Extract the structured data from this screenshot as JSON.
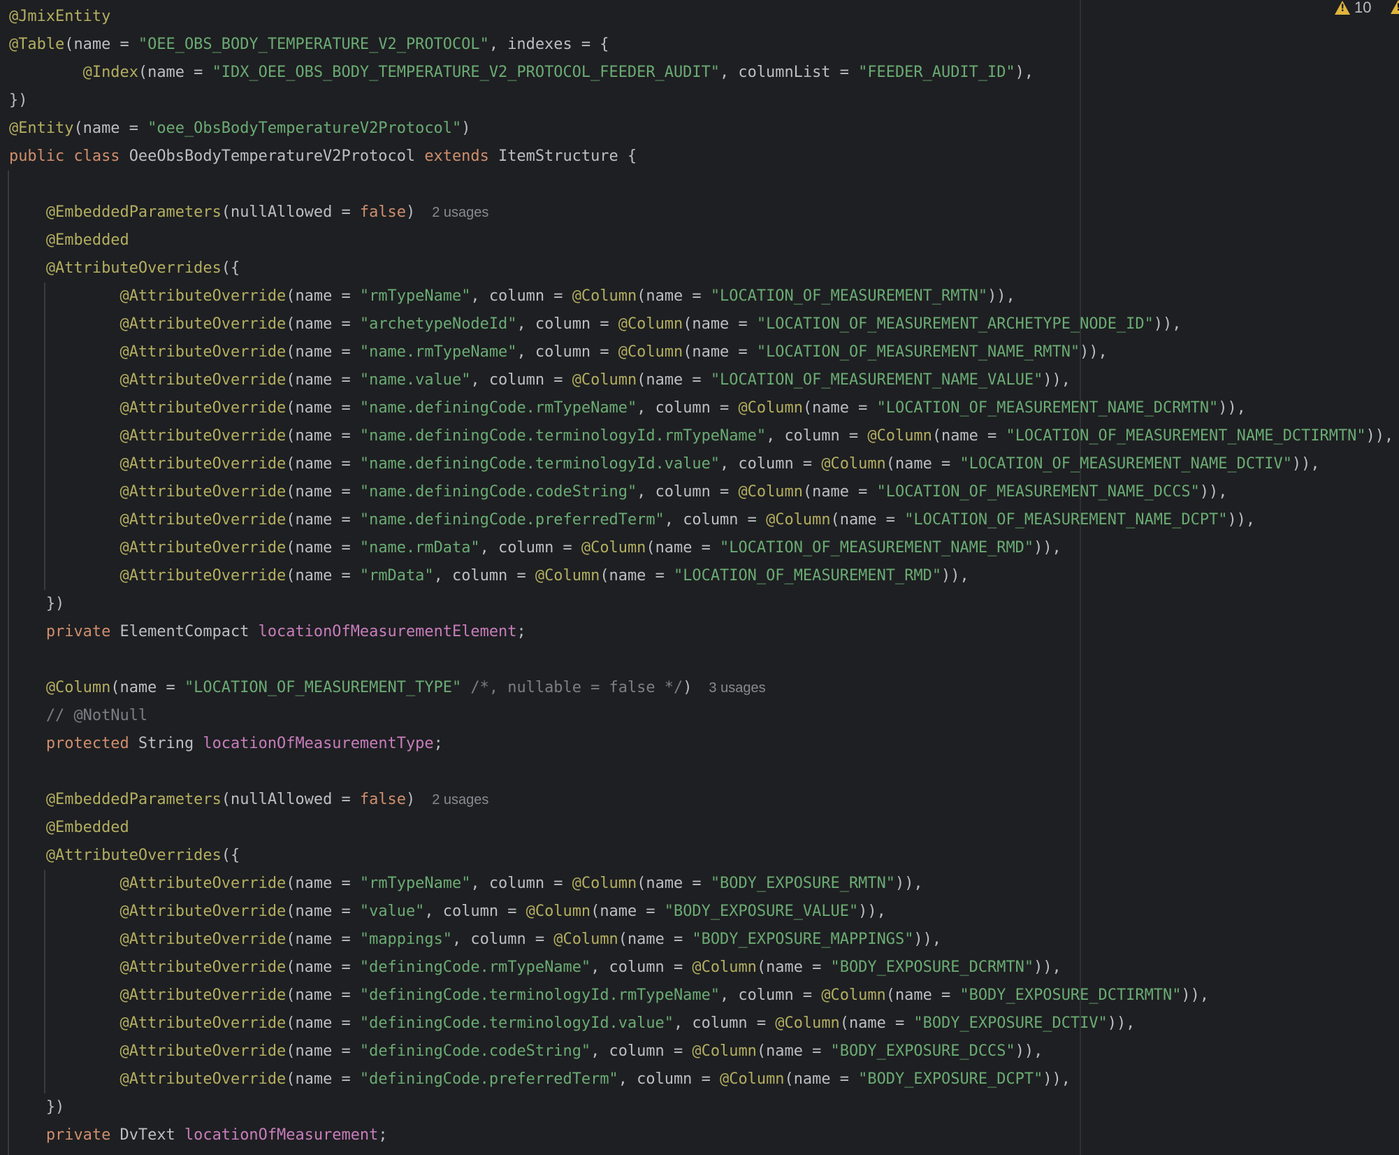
{
  "inspection": {
    "warning_count": "10"
  },
  "colors": {
    "background": "#1e1f22",
    "text": "#bcbec4",
    "annotation": "#b3ae60",
    "keyword": "#cf8e6d",
    "string": "#6aab73",
    "field": "#c77dbb",
    "comment": "#7a7e85",
    "hint": "#868a91",
    "warning": "#e0b53d"
  },
  "code": [
    [
      [
        "ann",
        "@JmixEntity"
      ]
    ],
    [
      [
        "ann",
        "@Table"
      ],
      [
        "txt",
        "(name = "
      ],
      [
        "str",
        "\"OEE_OBS_BODY_TEMPERATURE_V2_PROTOCOL\""
      ],
      [
        "txt",
        ", indexes = {"
      ]
    ],
    [
      [
        "txt",
        "        "
      ],
      [
        "ann",
        "@Index"
      ],
      [
        "txt",
        "(name = "
      ],
      [
        "str",
        "\"IDX_OEE_OBS_BODY_TEMPERATURE_V2_PROTOCOL_FEEDER_AUDIT\""
      ],
      [
        "txt",
        ", columnList = "
      ],
      [
        "str",
        "\"FEEDER_AUDIT_ID\""
      ],
      [
        "txt",
        "),"
      ]
    ],
    [
      [
        "txt",
        "})"
      ]
    ],
    [
      [
        "ann",
        "@Entity"
      ],
      [
        "txt",
        "(name = "
      ],
      [
        "str",
        "\"oee_ObsBodyTemperatureV2Protocol\""
      ],
      [
        "txt",
        ")"
      ]
    ],
    [
      [
        "kw",
        "public class "
      ],
      [
        "txt",
        "OeeObsBodyTemperatureV2Protocol "
      ],
      [
        "kw",
        "extends "
      ],
      [
        "txt",
        "ItemStructure {"
      ]
    ],
    [],
    [
      [
        "txt",
        "    "
      ],
      [
        "ann",
        "@EmbeddedParameters"
      ],
      [
        "txt",
        "(nullAllowed = "
      ],
      [
        "kw",
        "false"
      ],
      [
        "txt",
        ")"
      ],
      [
        "hint",
        "2 usages"
      ]
    ],
    [
      [
        "txt",
        "    "
      ],
      [
        "ann",
        "@Embedded"
      ]
    ],
    [
      [
        "txt",
        "    "
      ],
      [
        "ann",
        "@AttributeOverrides"
      ],
      [
        "txt",
        "({"
      ]
    ],
    [
      [
        "txt",
        "            "
      ],
      [
        "ann",
        "@AttributeOverride"
      ],
      [
        "txt",
        "(name = "
      ],
      [
        "str",
        "\"rmTypeName\""
      ],
      [
        "txt",
        ", column = "
      ],
      [
        "ann",
        "@Column"
      ],
      [
        "txt",
        "(name = "
      ],
      [
        "str",
        "\"LOCATION_OF_MEASUREMENT_RMTN\""
      ],
      [
        "txt",
        ")),"
      ]
    ],
    [
      [
        "txt",
        "            "
      ],
      [
        "ann",
        "@AttributeOverride"
      ],
      [
        "txt",
        "(name = "
      ],
      [
        "str",
        "\"archetypeNodeId\""
      ],
      [
        "txt",
        ", column = "
      ],
      [
        "ann",
        "@Column"
      ],
      [
        "txt",
        "(name = "
      ],
      [
        "str",
        "\"LOCATION_OF_MEASUREMENT_ARCHETYPE_NODE_ID\""
      ],
      [
        "txt",
        ")),"
      ]
    ],
    [
      [
        "txt",
        "            "
      ],
      [
        "ann",
        "@AttributeOverride"
      ],
      [
        "txt",
        "(name = "
      ],
      [
        "str",
        "\"name.rmTypeName\""
      ],
      [
        "txt",
        ", column = "
      ],
      [
        "ann",
        "@Column"
      ],
      [
        "txt",
        "(name = "
      ],
      [
        "str",
        "\"LOCATION_OF_MEASUREMENT_NAME_RMTN\""
      ],
      [
        "txt",
        ")),"
      ]
    ],
    [
      [
        "txt",
        "            "
      ],
      [
        "ann",
        "@AttributeOverride"
      ],
      [
        "txt",
        "(name = "
      ],
      [
        "str",
        "\"name.value\""
      ],
      [
        "txt",
        ", column = "
      ],
      [
        "ann",
        "@Column"
      ],
      [
        "txt",
        "(name = "
      ],
      [
        "str",
        "\"LOCATION_OF_MEASUREMENT_NAME_VALUE\""
      ],
      [
        "txt",
        ")),"
      ]
    ],
    [
      [
        "txt",
        "            "
      ],
      [
        "ann",
        "@AttributeOverride"
      ],
      [
        "txt",
        "(name = "
      ],
      [
        "str",
        "\"name.definingCode.rmTypeName\""
      ],
      [
        "txt",
        ", column = "
      ],
      [
        "ann",
        "@Column"
      ],
      [
        "txt",
        "(name = "
      ],
      [
        "str",
        "\"LOCATION_OF_MEASUREMENT_NAME_DCRMTN\""
      ],
      [
        "txt",
        ")),"
      ]
    ],
    [
      [
        "txt",
        "            "
      ],
      [
        "ann",
        "@AttributeOverride"
      ],
      [
        "txt",
        "(name = "
      ],
      [
        "str",
        "\"name.definingCode.terminologyId.rmTypeName\""
      ],
      [
        "txt",
        ", column = "
      ],
      [
        "ann",
        "@Column"
      ],
      [
        "txt",
        "(name = "
      ],
      [
        "str",
        "\"LOCATION_OF_MEASUREMENT_NAME_DCTIRMTN\""
      ],
      [
        "txt",
        ")),"
      ]
    ],
    [
      [
        "txt",
        "            "
      ],
      [
        "ann",
        "@AttributeOverride"
      ],
      [
        "txt",
        "(name = "
      ],
      [
        "str",
        "\"name.definingCode.terminologyId.value\""
      ],
      [
        "txt",
        ", column = "
      ],
      [
        "ann",
        "@Column"
      ],
      [
        "txt",
        "(name = "
      ],
      [
        "str",
        "\"LOCATION_OF_MEASUREMENT_NAME_DCTIV\""
      ],
      [
        "txt",
        ")),"
      ]
    ],
    [
      [
        "txt",
        "            "
      ],
      [
        "ann",
        "@AttributeOverride"
      ],
      [
        "txt",
        "(name = "
      ],
      [
        "str",
        "\"name.definingCode.codeString\""
      ],
      [
        "txt",
        ", column = "
      ],
      [
        "ann",
        "@Column"
      ],
      [
        "txt",
        "(name = "
      ],
      [
        "str",
        "\"LOCATION_OF_MEASUREMENT_NAME_DCCS\""
      ],
      [
        "txt",
        ")),"
      ]
    ],
    [
      [
        "txt",
        "            "
      ],
      [
        "ann",
        "@AttributeOverride"
      ],
      [
        "txt",
        "(name = "
      ],
      [
        "str",
        "\"name.definingCode.preferredTerm\""
      ],
      [
        "txt",
        ", column = "
      ],
      [
        "ann",
        "@Column"
      ],
      [
        "txt",
        "(name = "
      ],
      [
        "str",
        "\"LOCATION_OF_MEASUREMENT_NAME_DCPT\""
      ],
      [
        "txt",
        ")),"
      ]
    ],
    [
      [
        "txt",
        "            "
      ],
      [
        "ann",
        "@AttributeOverride"
      ],
      [
        "txt",
        "(name = "
      ],
      [
        "str",
        "\"name.rmData\""
      ],
      [
        "txt",
        ", column = "
      ],
      [
        "ann",
        "@Column"
      ],
      [
        "txt",
        "(name = "
      ],
      [
        "str",
        "\"LOCATION_OF_MEASUREMENT_NAME_RMD\""
      ],
      [
        "txt",
        ")),"
      ]
    ],
    [
      [
        "txt",
        "            "
      ],
      [
        "ann",
        "@AttributeOverride"
      ],
      [
        "txt",
        "(name = "
      ],
      [
        "str",
        "\"rmData\""
      ],
      [
        "txt",
        ", column = "
      ],
      [
        "ann",
        "@Column"
      ],
      [
        "txt",
        "(name = "
      ],
      [
        "str",
        "\"LOCATION_OF_MEASUREMENT_RMD\""
      ],
      [
        "txt",
        ")),"
      ]
    ],
    [
      [
        "txt",
        "    })"
      ]
    ],
    [
      [
        "txt",
        "    "
      ],
      [
        "kw",
        "private "
      ],
      [
        "txt",
        "ElementCompact "
      ],
      [
        "field",
        "locationOfMeasurementElement"
      ],
      [
        "txt",
        ";"
      ]
    ],
    [],
    [
      [
        "txt",
        "    "
      ],
      [
        "ann",
        "@Column"
      ],
      [
        "txt",
        "(name = "
      ],
      [
        "str",
        "\"LOCATION_OF_MEASUREMENT_TYPE\""
      ],
      [
        "txt",
        " "
      ],
      [
        "cmt",
        "/*, nullable = false */"
      ],
      [
        "txt",
        ")"
      ],
      [
        "hint",
        "3 usages"
      ]
    ],
    [
      [
        "txt",
        "    "
      ],
      [
        "cmt",
        "// @NotNull"
      ]
    ],
    [
      [
        "txt",
        "    "
      ],
      [
        "kw",
        "protected "
      ],
      [
        "txt",
        "String "
      ],
      [
        "field",
        "locationOfMeasurementType"
      ],
      [
        "txt",
        ";"
      ]
    ],
    [],
    [
      [
        "txt",
        "    "
      ],
      [
        "ann",
        "@EmbeddedParameters"
      ],
      [
        "txt",
        "(nullAllowed = "
      ],
      [
        "kw",
        "false"
      ],
      [
        "txt",
        ")"
      ],
      [
        "hint",
        "2 usages"
      ]
    ],
    [
      [
        "txt",
        "    "
      ],
      [
        "ann",
        "@Embedded"
      ]
    ],
    [
      [
        "txt",
        "    "
      ],
      [
        "ann",
        "@AttributeOverrides"
      ],
      [
        "txt",
        "({"
      ]
    ],
    [
      [
        "txt",
        "            "
      ],
      [
        "ann",
        "@AttributeOverride"
      ],
      [
        "txt",
        "(name = "
      ],
      [
        "str",
        "\"rmTypeName\""
      ],
      [
        "txt",
        ", column = "
      ],
      [
        "ann",
        "@Column"
      ],
      [
        "txt",
        "(name = "
      ],
      [
        "str",
        "\"BODY_EXPOSURE_RMTN\""
      ],
      [
        "txt",
        ")),"
      ]
    ],
    [
      [
        "txt",
        "            "
      ],
      [
        "ann",
        "@AttributeOverride"
      ],
      [
        "txt",
        "(name = "
      ],
      [
        "str",
        "\"value\""
      ],
      [
        "txt",
        ", column = "
      ],
      [
        "ann",
        "@Column"
      ],
      [
        "txt",
        "(name = "
      ],
      [
        "str",
        "\"BODY_EXPOSURE_VALUE\""
      ],
      [
        "txt",
        ")),"
      ]
    ],
    [
      [
        "txt",
        "            "
      ],
      [
        "ann",
        "@AttributeOverride"
      ],
      [
        "txt",
        "(name = "
      ],
      [
        "str",
        "\"mappings\""
      ],
      [
        "txt",
        ", column = "
      ],
      [
        "ann",
        "@Column"
      ],
      [
        "txt",
        "(name = "
      ],
      [
        "str",
        "\"BODY_EXPOSURE_MAPPINGS\""
      ],
      [
        "txt",
        ")),"
      ]
    ],
    [
      [
        "txt",
        "            "
      ],
      [
        "ann",
        "@AttributeOverride"
      ],
      [
        "txt",
        "(name = "
      ],
      [
        "str",
        "\"definingCode.rmTypeName\""
      ],
      [
        "txt",
        ", column = "
      ],
      [
        "ann",
        "@Column"
      ],
      [
        "txt",
        "(name = "
      ],
      [
        "str",
        "\"BODY_EXPOSURE_DCRMTN\""
      ],
      [
        "txt",
        ")),"
      ]
    ],
    [
      [
        "txt",
        "            "
      ],
      [
        "ann",
        "@AttributeOverride"
      ],
      [
        "txt",
        "(name = "
      ],
      [
        "str",
        "\"definingCode.terminologyId.rmTypeName\""
      ],
      [
        "txt",
        ", column = "
      ],
      [
        "ann",
        "@Column"
      ],
      [
        "txt",
        "(name = "
      ],
      [
        "str",
        "\"BODY_EXPOSURE_DCTIRMTN\""
      ],
      [
        "txt",
        ")),"
      ]
    ],
    [
      [
        "txt",
        "            "
      ],
      [
        "ann",
        "@AttributeOverride"
      ],
      [
        "txt",
        "(name = "
      ],
      [
        "str",
        "\"definingCode.terminologyId.value\""
      ],
      [
        "txt",
        ", column = "
      ],
      [
        "ann",
        "@Column"
      ],
      [
        "txt",
        "(name = "
      ],
      [
        "str",
        "\"BODY_EXPOSURE_DCTIV\""
      ],
      [
        "txt",
        ")),"
      ]
    ],
    [
      [
        "txt",
        "            "
      ],
      [
        "ann",
        "@AttributeOverride"
      ],
      [
        "txt",
        "(name = "
      ],
      [
        "str",
        "\"definingCode.codeString\""
      ],
      [
        "txt",
        ", column = "
      ],
      [
        "ann",
        "@Column"
      ],
      [
        "txt",
        "(name = "
      ],
      [
        "str",
        "\"BODY_EXPOSURE_DCCS\""
      ],
      [
        "txt",
        ")),"
      ]
    ],
    [
      [
        "txt",
        "            "
      ],
      [
        "ann",
        "@AttributeOverride"
      ],
      [
        "txt",
        "(name = "
      ],
      [
        "str",
        "\"definingCode.preferredTerm\""
      ],
      [
        "txt",
        ", column = "
      ],
      [
        "ann",
        "@Column"
      ],
      [
        "txt",
        "(name = "
      ],
      [
        "str",
        "\"BODY_EXPOSURE_DCPT\""
      ],
      [
        "txt",
        ")),"
      ]
    ],
    [
      [
        "txt",
        "    })"
      ]
    ],
    [
      [
        "txt",
        "    "
      ],
      [
        "kw",
        "private "
      ],
      [
        "txt",
        "DvText "
      ],
      [
        "field",
        "locationOfMeasurement"
      ],
      [
        "txt",
        ";"
      ]
    ]
  ]
}
